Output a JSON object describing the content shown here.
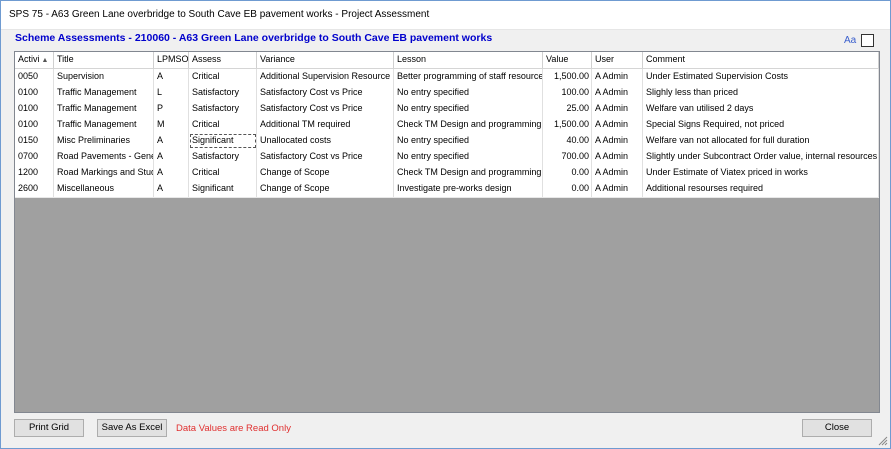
{
  "window": {
    "title": "SPS 75 - A63 Green Lane overbridge to South  Cave EB pavement works - Project Assessment"
  },
  "heading": "Scheme Assessments - 210060 - A63 Green Lane overbridge to South  Cave EB pavement works",
  "font_toggle": {
    "label": "Aa",
    "checked": false
  },
  "grid": {
    "columns": [
      "Activi",
      "Title",
      "LPMSO",
      "Assess",
      "Variance",
      "Lesson",
      "Value",
      "User",
      "Comment"
    ],
    "sort_column": "Activi",
    "rows": [
      [
        "0050",
        "Supervision",
        "A",
        "Critical",
        "Additional Supervision Resource",
        "Better programming of staff resource",
        "1,500.00",
        "A Admin",
        "Under Estimated Supervision Costs"
      ],
      [
        "0100",
        "Traffic Management",
        "L",
        "Satisfactory",
        "Satisfactory Cost vs Price",
        "No entry specified",
        "100.00",
        "A Admin",
        "Slighly less than priced"
      ],
      [
        "0100",
        "Traffic Management",
        "P",
        "Satisfactory",
        "Satisfactory Cost vs Price",
        "No entry specified",
        "25.00",
        "A Admin",
        "Welfare van utilised 2 days"
      ],
      [
        "0100",
        "Traffic Management",
        "M",
        "Critical",
        "Additional TM required",
        "Check TM Design and programming",
        "1,500.00",
        "A Admin",
        "Special Signs Required, not priced"
      ],
      [
        "0150",
        "Misc Preliminaries",
        "A",
        "Significant",
        "Unallocated costs",
        "No entry specified",
        "40.00",
        "A Admin",
        "Welfare van not allocated for full duration"
      ],
      [
        "0700",
        "Road Pavements - General",
        "A",
        "Satisfactory",
        "Satisfactory Cost vs Price",
        "No entry specified",
        "700.00",
        "A Admin",
        "Slightly under Subcontract Order value, internal resources"
      ],
      [
        "1200",
        "Road Markings and Studs",
        "A",
        "Critical",
        "Change of Scope",
        "Check TM Design and programming",
        "0.00",
        "A Admin",
        "Under Estimate of Viatex priced in works"
      ],
      [
        "2600",
        "Miscellaneous",
        "A",
        "Significant",
        "Change of Scope",
        "Investigate pre-works design",
        "0.00",
        "A Admin",
        "Additional resourses required"
      ]
    ],
    "selected": {
      "row": 4,
      "col": 3
    }
  },
  "buttons": {
    "print": "Print Grid",
    "excel": "Save As Excel",
    "close": "Close"
  },
  "status": "Data Values are Read Only",
  "colors": {
    "heading": "#0000cc",
    "status": "#e03030",
    "grid_background": "#a0a0a0"
  }
}
